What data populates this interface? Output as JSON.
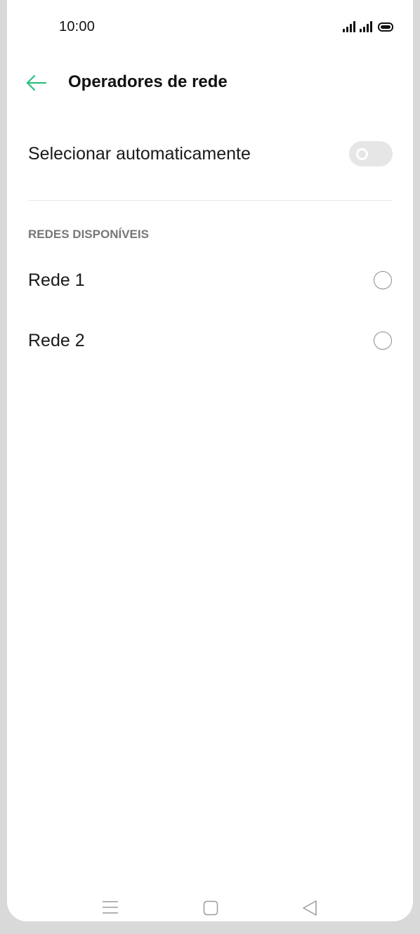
{
  "status_bar": {
    "time": "10:00",
    "icons": [
      "signal-icon",
      "signal-icon",
      "battery-icon"
    ]
  },
  "header": {
    "title": "Operadores de rede",
    "back_icon": "back-arrow-icon",
    "accent_color": "#2bbf7e"
  },
  "auto_select": {
    "label": "Selecionar automaticamente",
    "enabled": false
  },
  "networks_section": {
    "label": "REDES DISPONÍVEIS",
    "items": [
      {
        "label": "Rede 1",
        "selected": false
      },
      {
        "label": "Rede 2",
        "selected": false
      }
    ]
  },
  "nav_bar": {
    "icons": [
      "menu-icon",
      "home-icon",
      "back-icon"
    ]
  }
}
